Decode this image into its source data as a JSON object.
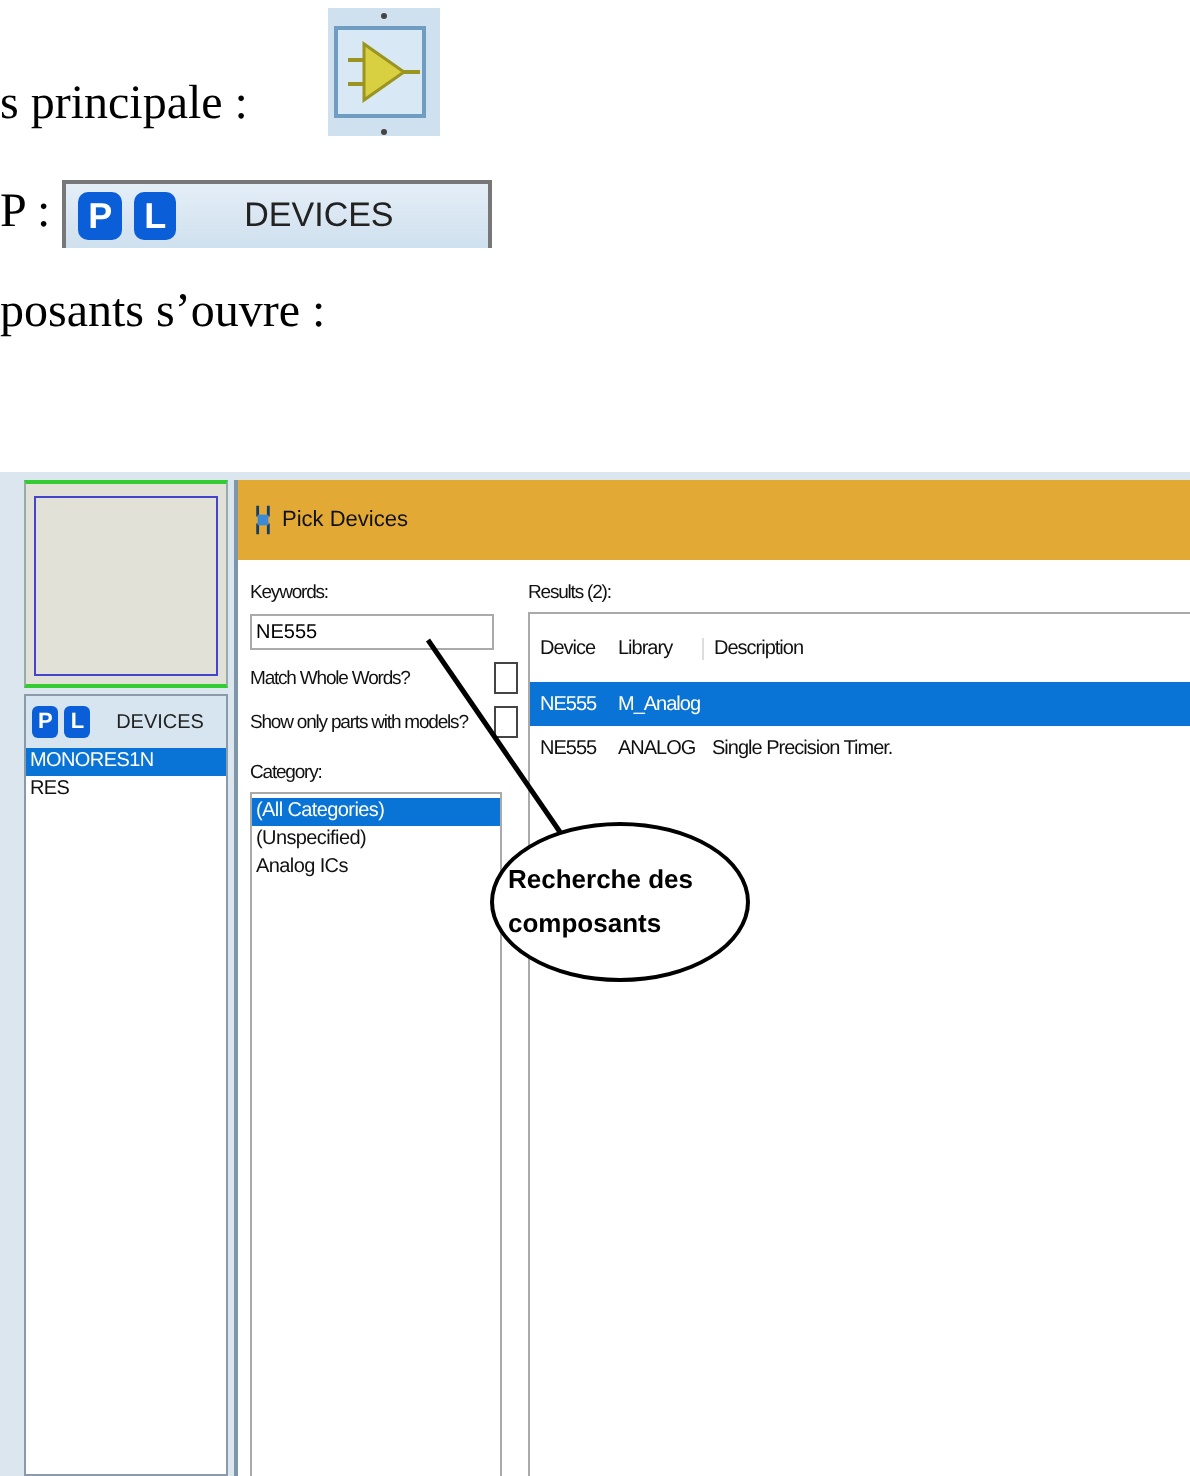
{
  "document": {
    "lines": [
      {
        "text": "s principale :",
        "kind": "icon"
      },
      {
        "text": "P :",
        "kind": "devices_bar",
        "bar": {
          "p": "P",
          "l": "L",
          "title": "DEVICES"
        }
      },
      {
        "text": "posants s’ouvre :",
        "kind": "plain"
      }
    ]
  },
  "devices_panel": {
    "p": "P",
    "l": "L",
    "title": "DEVICES",
    "items": [
      {
        "label": "MONORES1N",
        "selected": true
      },
      {
        "label": "RES",
        "selected": false
      }
    ]
  },
  "dialog": {
    "title": "Pick Devices",
    "keywords_label": "Keywords:",
    "keywords_value": "NE555",
    "options": [
      {
        "label": "Match Whole Words?",
        "checked": false
      },
      {
        "label": "Show only parts with models?",
        "checked": false
      }
    ],
    "category_label": "Category:",
    "categories": [
      {
        "label": "(All Categories)",
        "selected": true
      },
      {
        "label": "(Unspecified)",
        "selected": false
      },
      {
        "label": "Analog ICs",
        "selected": false
      }
    ],
    "results_label": "Results (2):",
    "columns": [
      "Device",
      "Library",
      "Description"
    ],
    "rows": [
      {
        "cells": [
          "NE555",
          "M_Analog"
        ],
        "selected": true
      },
      {
        "cells": [
          "NE555",
          "ANALOG",
          "Single Precision Timer."
        ],
        "selected": false
      }
    ]
  },
  "callout": {
    "text": "Recherche des composants"
  }
}
